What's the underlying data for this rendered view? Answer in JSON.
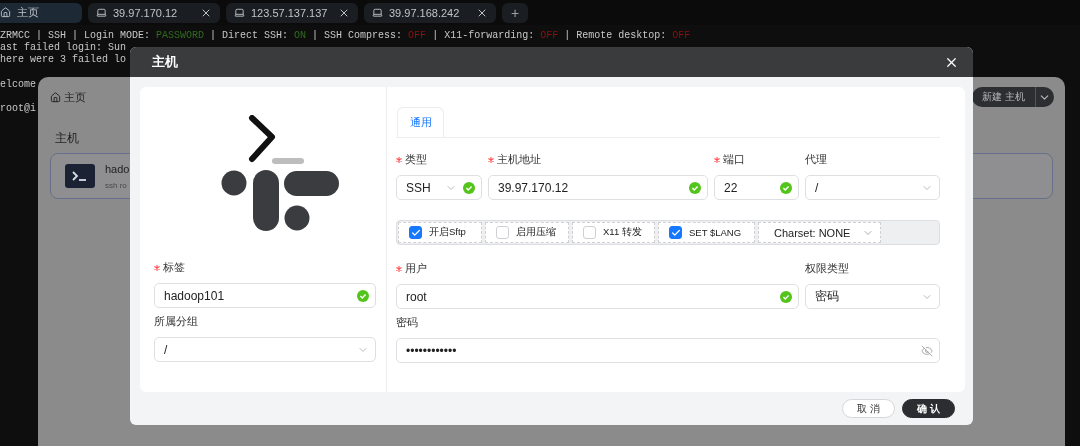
{
  "tabs": [
    {
      "kind": "home",
      "label": "主页",
      "selected": true
    },
    {
      "kind": "host",
      "label": "39.97.170.12",
      "selected": false
    },
    {
      "kind": "host",
      "label": "123.57.137.137",
      "selected": false
    },
    {
      "kind": "host",
      "label": "39.97.168.242",
      "selected": false
    }
  ],
  "add_tab": "+",
  "terminal": {
    "lines": [
      {
        "segments": [
          {
            "text": "ZRMCC | SSH | Login MODE: "
          },
          {
            "text": "PASSWORD",
            "color": "#2f6b1f"
          },
          {
            "text": " | Direct SSH: "
          },
          {
            "text": "ON",
            "color": "#2f6b1f"
          },
          {
            "text": " | SSH Compress: "
          },
          {
            "text": "OFF",
            "color": "#8b1010"
          },
          {
            "text": " | X11-forwarding: "
          },
          {
            "text": "OFF",
            "color": "#8b1010"
          },
          {
            "text": " | Remote desktop: "
          },
          {
            "text": "OFF",
            "color": "#8b1010"
          }
        ]
      },
      {
        "segments": [
          {
            "text": "ast failed login: Sun"
          }
        ]
      },
      {
        "segments": [
          {
            "text": "here were 3 failed lo"
          }
        ]
      }
    ],
    "spaced_lines": [
      {
        "segments": [
          {
            "text": "elcome"
          }
        ]
      },
      {
        "segments": [
          {
            "text": "root@i"
          }
        ]
      }
    ]
  },
  "hosts_page": {
    "breadcrumb": "主页",
    "heading": "主机",
    "new_button": "新建 主机",
    "host_card": {
      "title": "hado",
      "subtitle": "ssh ro"
    }
  },
  "dialog": {
    "title": "主机",
    "tabs": [
      {
        "label": "通用",
        "selected": true
      }
    ],
    "left_fields": [
      {
        "kind": "input",
        "label": "标签",
        "required": true,
        "value": "hadoop101",
        "valid": true
      },
      {
        "kind": "select",
        "label": "所属分组",
        "required": false,
        "value": "/",
        "valid": false
      }
    ],
    "connection_fields": [
      {
        "kind": "select",
        "label": "类型",
        "required": true,
        "value": "SSH",
        "valid": true
      },
      {
        "kind": "input",
        "label": "主机地址",
        "required": true,
        "value": "39.97.170.12",
        "valid": true
      },
      {
        "kind": "input",
        "label": "端口",
        "required": true,
        "value": "22",
        "valid": true
      },
      {
        "kind": "select",
        "label": "代理",
        "required": false,
        "value": "/",
        "valid": false
      }
    ],
    "options": [
      {
        "kind": "checkbox",
        "label": "开启Sftp",
        "checked": true
      },
      {
        "kind": "checkbox",
        "label": "启用压缩",
        "checked": false
      },
      {
        "kind": "checkbox",
        "label": "X11 转发",
        "checked": false
      },
      {
        "kind": "checkbox",
        "label": "SET $LANG",
        "checked": true
      },
      {
        "kind": "select",
        "label": "Charset: NONE"
      }
    ],
    "credential_fields": [
      {
        "kind": "input",
        "label": "用户",
        "required": true,
        "value": "root",
        "valid": true
      },
      {
        "kind": "select",
        "label": "权限类型",
        "required": false,
        "value": "密码",
        "valid": false
      },
      {
        "kind": "password",
        "label": "密码",
        "required": false,
        "value": "••••••••••••",
        "valid": false
      }
    ],
    "buttons": [
      {
        "label": "取 消",
        "kind": "secondary"
      },
      {
        "label": "确 认",
        "kind": "primary"
      }
    ]
  }
}
